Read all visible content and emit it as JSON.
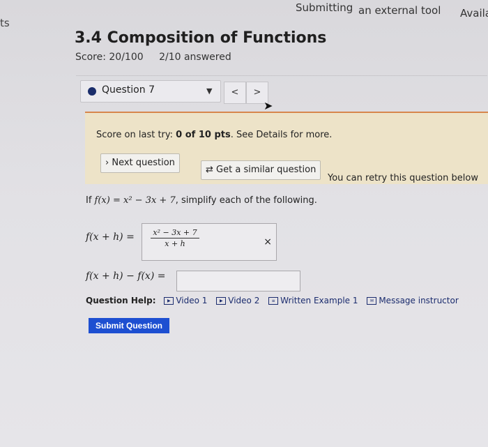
{
  "topbar": {
    "submitting": "Submitting",
    "external_tool": "an external tool",
    "available": "Availa",
    "left_fragment": "ts"
  },
  "assignment": {
    "title": "3.4 Composition of Functions",
    "score": "Score: 20/100",
    "answered": "2/10 answered"
  },
  "question_nav": {
    "current": "Question 7",
    "prev": "<",
    "next": ">"
  },
  "retry": {
    "prefix": "Score on last try: ",
    "score": "0 of 10 pts",
    "suffix": ". See Details for more.",
    "next_question": "Next question",
    "similar_question": "Get a similar question",
    "note": "You can retry this question below"
  },
  "problem": {
    "lead": "If ",
    "function": "f(x) = x² − 3x + 7",
    "tail": ", simplify each of the following."
  },
  "answers": {
    "first_label": "f(x + h) =",
    "first_numerator": "x² − 3x + 7",
    "first_denominator": "x + h",
    "clear": "×",
    "second_label": "f(x + h) − f(x) ="
  },
  "help": {
    "label": "Question Help:",
    "video1": "Video 1",
    "video2": "Video 2",
    "example": "Written Example 1",
    "message": "Message instructor"
  },
  "submit": "Submit Question",
  "colors": {
    "accent": "#1d4fd1",
    "link": "#1b2c6e",
    "retry_bg": "#ede3c8",
    "retry_border": "#d7864c"
  }
}
